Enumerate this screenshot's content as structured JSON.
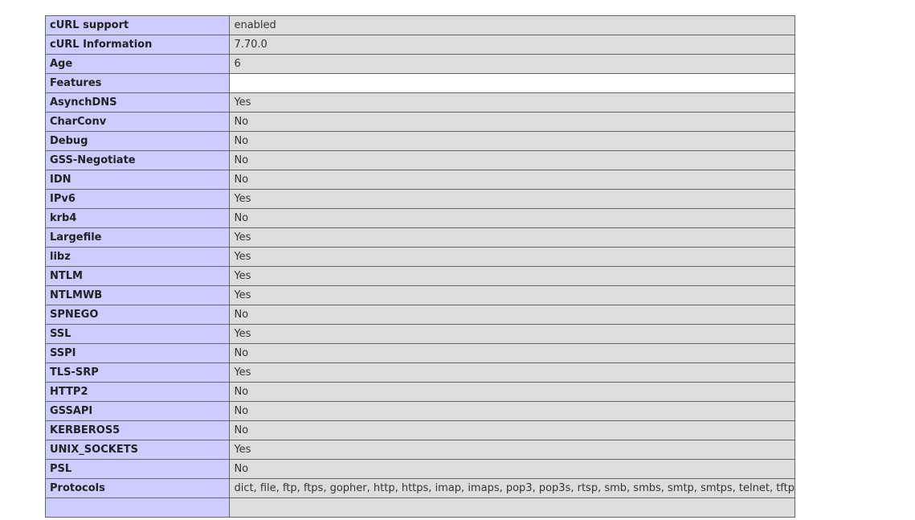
{
  "rows": [
    {
      "key": "cURL support",
      "value": "enabled"
    },
    {
      "key": "cURL Information",
      "value": "7.70.0"
    },
    {
      "key": "Age",
      "value": "6"
    },
    {
      "key": "Features",
      "value": ""
    },
    {
      "key": "AsynchDNS",
      "value": "Yes"
    },
    {
      "key": "CharConv",
      "value": "No"
    },
    {
      "key": "Debug",
      "value": "No"
    },
    {
      "key": "GSS-Negotiate",
      "value": "No"
    },
    {
      "key": "IDN",
      "value": "No"
    },
    {
      "key": "IPv6",
      "value": "Yes"
    },
    {
      "key": "krb4",
      "value": "No"
    },
    {
      "key": "Largefile",
      "value": "Yes"
    },
    {
      "key": "libz",
      "value": "Yes"
    },
    {
      "key": "NTLM",
      "value": "Yes"
    },
    {
      "key": "NTLMWB",
      "value": "Yes"
    },
    {
      "key": "SPNEGO",
      "value": "No"
    },
    {
      "key": "SSL",
      "value": "Yes"
    },
    {
      "key": "SSPI",
      "value": "No"
    },
    {
      "key": "TLS-SRP",
      "value": "Yes"
    },
    {
      "key": "HTTP2",
      "value": "No"
    },
    {
      "key": "GSSAPI",
      "value": "No"
    },
    {
      "key": "KERBEROS5",
      "value": "No"
    },
    {
      "key": "UNIX_SOCKETS",
      "value": "Yes"
    },
    {
      "key": "PSL",
      "value": "No"
    },
    {
      "key": "Protocols",
      "value": "dict, file, ftp, ftps, gopher, http, https, imap, imaps, pop3, pop3s, rtsp, smb, smbs, smtp, smtps, telnet, tftp"
    },
    {
      "key": "",
      "value": ""
    }
  ],
  "colors": {
    "key_bg": "#ccccff",
    "value_bg": "#dddddd",
    "border": "#666666"
  }
}
